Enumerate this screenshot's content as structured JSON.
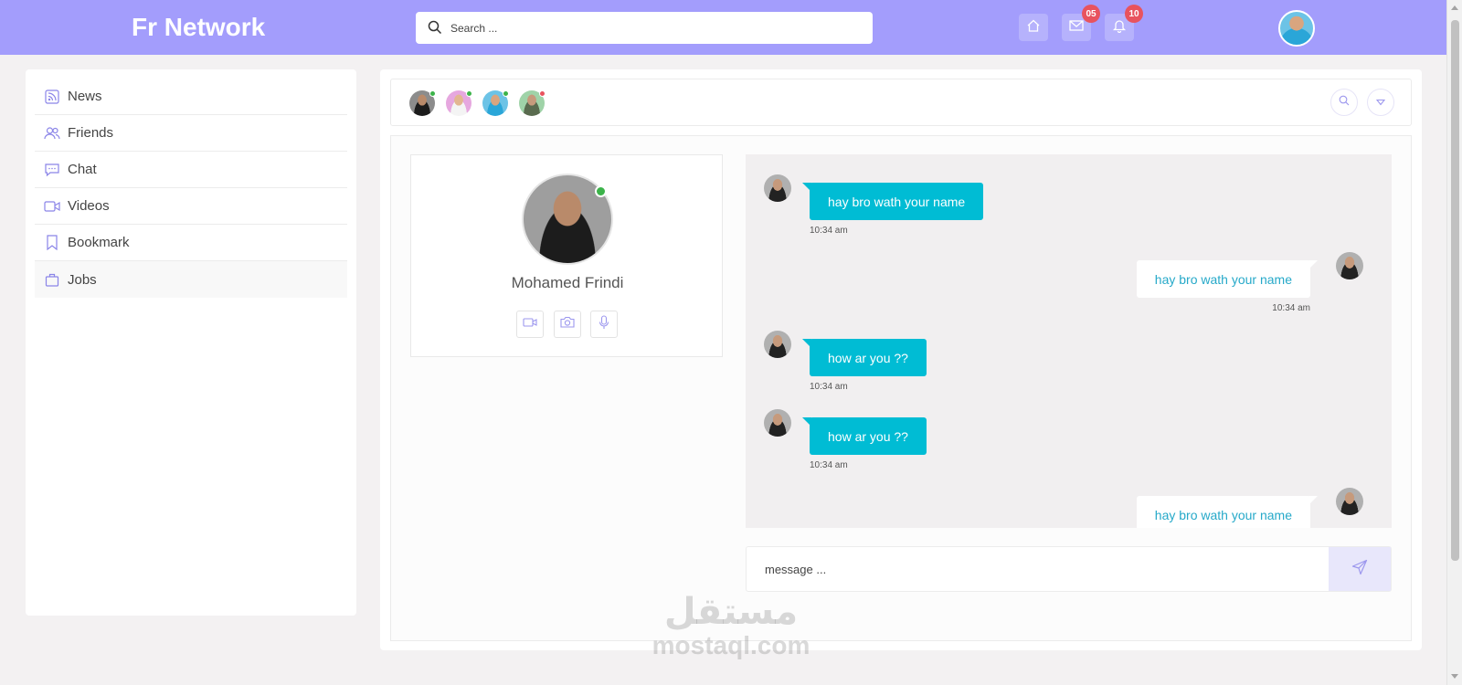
{
  "header": {
    "brand": "Fr Network",
    "search_placeholder": "Search ...",
    "mail_badge": "05",
    "notifications_badge": "10"
  },
  "sidebar": {
    "items": [
      {
        "label": "News",
        "icon": "rss-icon"
      },
      {
        "label": "Friends",
        "icon": "users-icon"
      },
      {
        "label": "Chat",
        "icon": "chat-icon"
      },
      {
        "label": "Videos",
        "icon": "video-icon"
      },
      {
        "label": "Bookmark",
        "icon": "bookmark-icon"
      },
      {
        "label": "Jobs",
        "icon": "briefcase-icon"
      }
    ]
  },
  "profile": {
    "name": "Mohamed Frindi",
    "status": "online"
  },
  "messages": [
    {
      "direction": "in",
      "text": "hay bro wath your name",
      "time": "10:34 am"
    },
    {
      "direction": "out",
      "text": "hay bro wath your name",
      "time": "10:34 am"
    },
    {
      "direction": "in",
      "text": "how ar you ??",
      "time": "10:34 am"
    },
    {
      "direction": "in",
      "text": "how ar you ??",
      "time": "10:34 am"
    },
    {
      "direction": "out",
      "text": "hay bro wath your name"
    }
  ],
  "composer": {
    "placeholder": "message ..."
  },
  "watermark": {
    "arabic": "مستقل",
    "latin": "mostaql.com"
  },
  "colors": {
    "header_bg": "#a39dfc",
    "accent": "#00bcd4",
    "badge": "#e8535e",
    "online": "#3cb34a"
  }
}
